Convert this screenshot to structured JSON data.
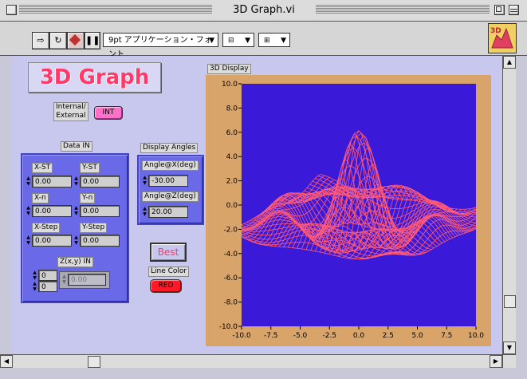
{
  "window": {
    "title": "3D Graph.vi"
  },
  "toolbar": {
    "font_select": "9pt アプリケーション・フォント",
    "icon_label": "3D"
  },
  "panel": {
    "title": "3D Graph",
    "int_ext_label_1": "Internal/",
    "int_ext_label_2": "External",
    "int_button": "INT",
    "data_in_label": "Data IN",
    "x_st_label": "X-ST",
    "y_st_label": "Y-ST",
    "x_st_value": "0.00",
    "y_st_value": "0.00",
    "x_n_label": "X-n",
    "y_n_label": "Y-n",
    "x_n_value": "0.00",
    "y_n_value": "0.00",
    "x_step_label": "X-Step",
    "y_step_label": "Y-Step",
    "x_step_value": "0.00",
    "y_step_value": "0.00",
    "zxy_label": "Z(x,y) IN",
    "zxy_index_1": "0",
    "zxy_index_2": "0",
    "zxy_value": "0.00",
    "display_angles_label": "Display Angles",
    "angle_x_label": "Angle@X(deg)",
    "angle_x_value": "-30.00",
    "angle_z_label": "Angle@Z(deg)",
    "angle_z_value": "20.00",
    "best_button": "Best",
    "line_color_label": "Line Color",
    "red_button": "RED",
    "display_label": "3D Display"
  },
  "colors": {
    "plot_bg": "#3a1ad8",
    "mesh": "#ff5a78",
    "frame": "#d9a46a",
    "cluster": "#6a6ae8",
    "title_text": "#ff3a6a",
    "int_button": "#ff70c8",
    "red_button": "#ff1a2a"
  },
  "chart_data": {
    "type": "surface",
    "ylim": [
      -10.0,
      10.0
    ],
    "xlim": [
      -10.0,
      10.0
    ],
    "y_ticks": [
      "10.0",
      "8.0",
      "6.0",
      "4.0",
      "2.0",
      "0.0",
      "-2.0",
      "-4.0",
      "-6.0",
      "-8.0",
      "-10.0"
    ],
    "x_ticks": [
      "-10.0",
      "-7.5",
      "-5.0",
      "-2.5",
      "0.0",
      "2.5",
      "5.0",
      "7.5",
      "10.0"
    ],
    "grid_n": 40,
    "angle_x_deg": -30,
    "angle_z_deg": 20
  }
}
